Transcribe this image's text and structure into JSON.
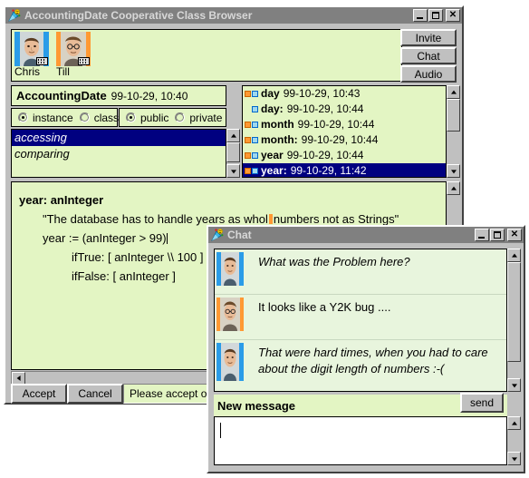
{
  "main_window": {
    "title": "AccountingDate Cooperative Class Browser",
    "app_icon": "party-popper-icon",
    "controls": {
      "minimize": "minimize-icon",
      "maximize": "maximize-icon",
      "close": "close-icon"
    },
    "people": [
      {
        "name": "Chris",
        "avatar_bg": "#2a9ce8",
        "icon_overlay": "keyboard-icon"
      },
      {
        "name": "Till",
        "avatar_bg": "#ff9933",
        "icon_overlay": "keyboard-icon"
      }
    ],
    "side_buttons": [
      {
        "label": "Invite"
      },
      {
        "label": "Chat"
      },
      {
        "label": "Audio"
      }
    ],
    "class_header": {
      "class_name": "AccountingDate",
      "timestamp": "99-10-29, 10:40"
    },
    "scope_radios": [
      {
        "label": "instance",
        "selected": true
      },
      {
        "label": "class",
        "selected": false
      }
    ],
    "visibility_radios": [
      {
        "label": "public",
        "selected": true
      },
      {
        "label": "private",
        "selected": false
      }
    ],
    "categories": [
      {
        "label": "accessing",
        "selected": true
      },
      {
        "label": "comparing",
        "selected": false
      }
    ],
    "methods": [
      {
        "name": "day",
        "timestamp": "99-10-29, 10:43",
        "icons": [
          "orange",
          "blue"
        ],
        "selected": false
      },
      {
        "name": "day:",
        "timestamp": "99-10-29, 10:44",
        "icons": [
          "blue"
        ],
        "selected": false
      },
      {
        "name": "month",
        "timestamp": "99-10-29, 10:44",
        "icons": [
          "orange",
          "blue"
        ],
        "selected": false
      },
      {
        "name": "month:",
        "timestamp": "99-10-29, 10:44",
        "icons": [
          "orange",
          "blue"
        ],
        "selected": false
      },
      {
        "name": "year",
        "timestamp": "99-10-29, 10:44",
        "icons": [
          "orange",
          "blue"
        ],
        "selected": false
      },
      {
        "name": "year:",
        "timestamp": "99-10-29, 11:42",
        "icons": [
          "orange",
          "blue"
        ],
        "selected": true
      }
    ],
    "code": {
      "signature": "year: anInteger",
      "comment_before_caret": "\"The database has to handle years as whol",
      "comment_after_caret": "numbers not as Strings\"",
      "line_assign": "year := (anInteger > 99)",
      "line_iftrue": "ifTrue: [ anInteger \\\\ 100 ]",
      "line_iffalse": "ifFalse: [ anInteger ]"
    },
    "buttons": [
      {
        "label": "Accept"
      },
      {
        "label": "Cancel"
      }
    ],
    "status_text": "Please accept or cancel"
  },
  "chat_window": {
    "title": "Chat",
    "app_icon": "party-popper-icon",
    "controls": {
      "minimize": "minimize-icon",
      "maximize": "maximize-icon",
      "close": "close-icon"
    },
    "messages": [
      {
        "author": "Chris",
        "avatar_bg": "#2a9ce8",
        "text": "What was the Problem here?",
        "italic": true
      },
      {
        "author": "Till",
        "avatar_bg": "#ff9933",
        "text": "It looks like a Y2K bug ....",
        "italic": false
      },
      {
        "author": "Chris",
        "avatar_bg": "#2a9ce8",
        "text": "That were hard times, when you had to care about the digit length of numbers :-(",
        "italic": true
      }
    ],
    "new_message_label": "New message",
    "send_label": "send",
    "new_message_value": ""
  },
  "colors": {
    "window_face": "#c0c0c0",
    "title_bar": "#808080",
    "field_green": "#e3f5c3",
    "selection_blue": "#000080",
    "accent_orange": "#ff9933",
    "accent_blue": "#2a9ce8"
  }
}
